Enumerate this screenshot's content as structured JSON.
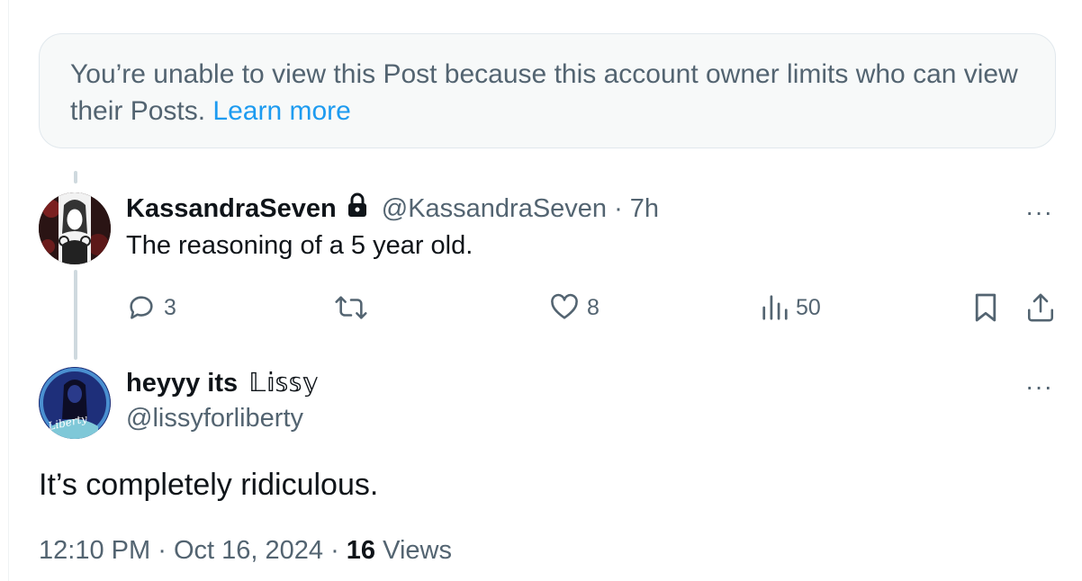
{
  "notice": {
    "text": "You’re unable to view this Post because this account owner limits who can view their Posts.",
    "link": "Learn more"
  },
  "reply": {
    "name": "KassandraSeven",
    "handle": "@KassandraSeven",
    "separator": "·",
    "time": "7h",
    "text": "The reasoning of a 5 year old.",
    "more": "···",
    "actions": {
      "replies": "3",
      "likes": "8",
      "views": "50"
    }
  },
  "main_post": {
    "name": "heyyy its",
    "name_styled": "𝕃𝕚𝕤𝕤𝕪",
    "handle": "@lissyforliberty",
    "more": "···",
    "text": "It’s completely ridiculous.",
    "time": "12:10 PM",
    "separator": "·",
    "date": "Oct 16, 2024",
    "views_count": "16",
    "views_label": "Views"
  },
  "icons": {
    "lock": "lock-icon",
    "reply": "reply-icon",
    "repost": "repost-icon",
    "like": "heart-icon",
    "views": "views-icon",
    "bookmark": "bookmark-icon",
    "share": "share-icon"
  },
  "colors": {
    "link": "#1d9bf0",
    "muted": "#536471",
    "text": "#0f1419",
    "notice_bg": "#f7f9f9"
  }
}
